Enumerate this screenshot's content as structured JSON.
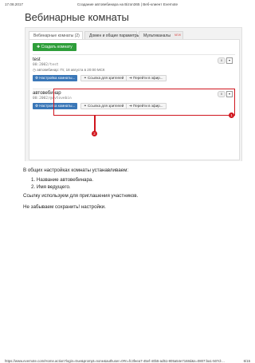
{
  "page_header": {
    "date": "17.08.2017",
    "title": "Создание автовебинара на Bizon365 | Веб-клиент Evernote"
  },
  "page_footer": {
    "url": "https://www.evernote.com/Home.action?login=true&prompt=none&authuser=0#n=fc3feea7-45ef-40b5-ad51-805a54e7168d&s=0807:ba1-507d-...",
    "page_number": "6/15"
  },
  "screenshot": {
    "heading": "Вебинарные комнаты",
    "tabs": [
      {
        "label": "Вебинарные комнаты (2)",
        "active": true
      },
      {
        "label": "Домен и общие параметры",
        "active": false
      },
      {
        "label": "Мультиканалы",
        "active": false,
        "badge": "NEW"
      }
    ],
    "create_button": "Создать комнату",
    "rooms": [
      {
        "name": "test",
        "id": "00:2002/test",
        "schedule": "автовебинар: Пт, 18 августа в 20:00 МСК",
        "settings_button": "Настройка комнаты...",
        "viewer_link_button": "Ссылка для зрителей",
        "go_button": "Перейти в эфир...",
        "count": "0"
      },
      {
        "name": "автовебинар",
        "id": "00:2002/@avtovebin",
        "settings_button": "Настройка комнаты...",
        "viewer_link_button": "Ссылка для зрителей",
        "go_button": "Перейти в эфир...",
        "count": "0"
      }
    ],
    "markers": [
      "1",
      "2"
    ]
  },
  "body_text": {
    "intro": "В общих настройках комнаты устанавливаем:",
    "items": [
      "1. Название автовебинара.",
      "2. Имя ведущего."
    ],
    "para1": "Ссылку используем для приглашения участников.",
    "para2": "Не забываем сохранить! настройки."
  },
  "colors": {
    "accent_red": "#d0161e",
    "create_green": "#2e9e3a",
    "primary_blue": "#3a77b8"
  }
}
